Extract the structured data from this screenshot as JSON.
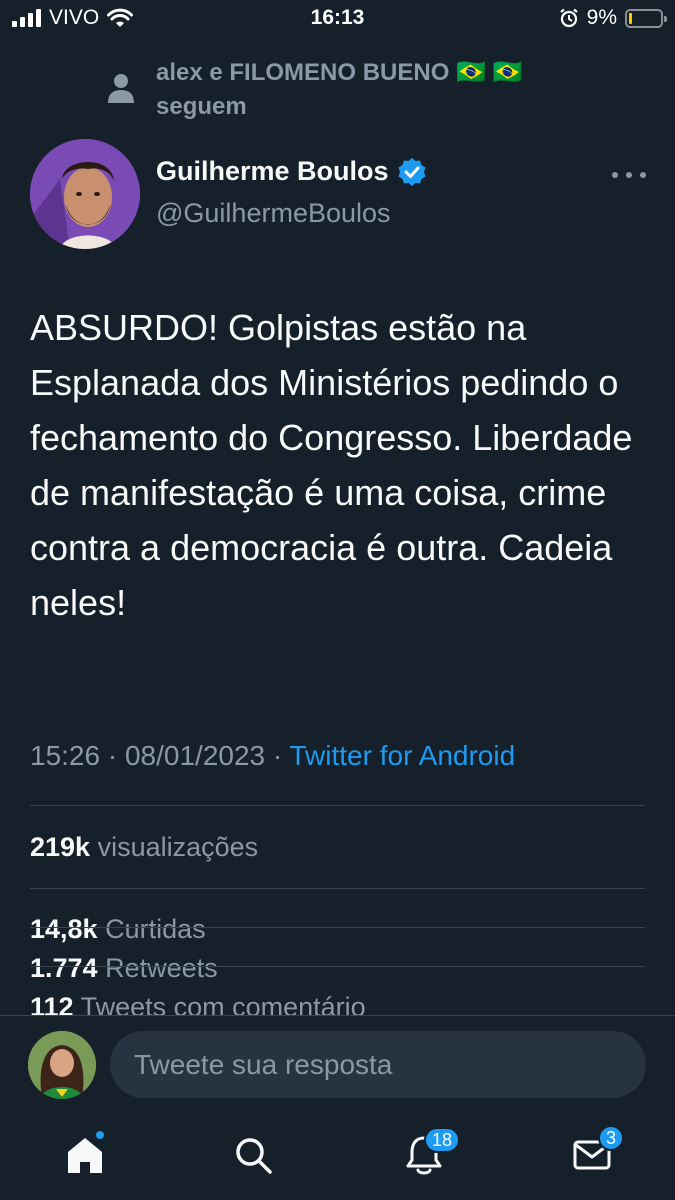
{
  "status_bar": {
    "carrier": "VIVO",
    "time": "16:13",
    "battery": "9%",
    "battery_level": 0.09
  },
  "social_context": {
    "text": "alex e FILOMENO BUENO 🇧🇷 🇧🇷 seguem"
  },
  "author": {
    "name": "Guilherme Boulos",
    "handle": "@GuilhermeBoulos",
    "verified": true
  },
  "tweet": {
    "text": "ABSURDO! Golpistas estão na Esplanada dos Ministérios pedindo o fechamento do Congresso. Liberdade de manifestação é uma coisa, crime contra a democracia é outra. Cadeia neles!",
    "time": "15:26",
    "separator": "·",
    "date": "08/01/2023",
    "source": "Twitter for Android"
  },
  "stats": {
    "views_count": "219k",
    "views_label": "visualizações",
    "likes_count": "14,8k",
    "likes_label": "Curtidas",
    "retweets_count": "1.774",
    "retweets_label": "Retweets",
    "quotes_count": "112",
    "quotes_label": "Tweets com comentário"
  },
  "reply": {
    "placeholder": "Tweete sua resposta"
  },
  "bottom_nav": {
    "notifications_badge": "18",
    "messages_badge": "3"
  },
  "colors": {
    "background": "#15202b",
    "accent": "#1d9bf0",
    "secondary_text": "#8b98a5",
    "divider": "#38444d"
  },
  "icons": [
    "signal-icon",
    "wifi-icon",
    "alarm-icon",
    "battery-icon",
    "person-icon",
    "verified-icon",
    "more-icon",
    "home-icon",
    "search-icon",
    "bell-icon",
    "mail-icon"
  ]
}
